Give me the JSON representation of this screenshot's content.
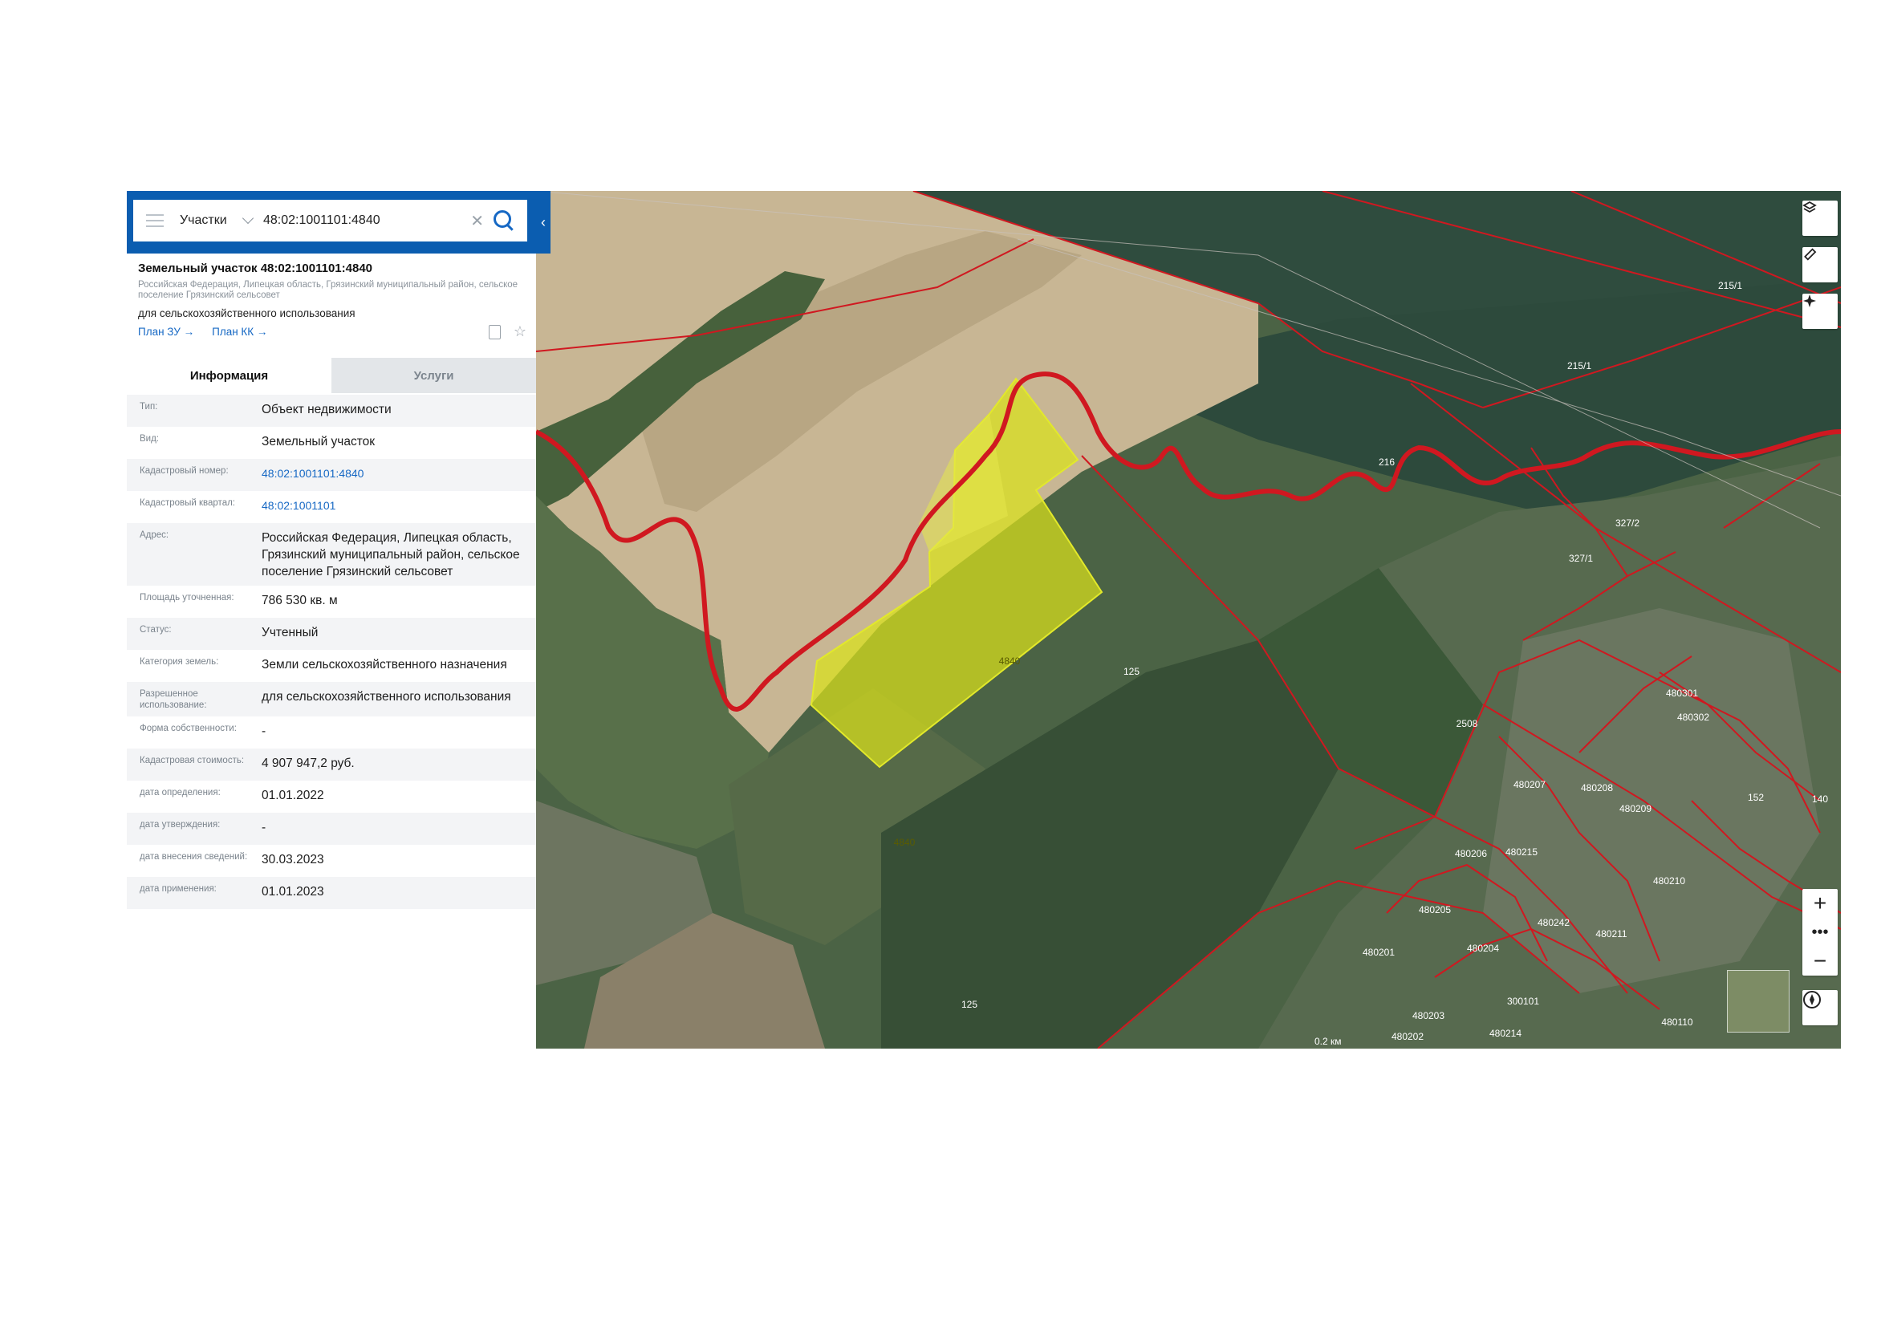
{
  "search": {
    "layer": "Участки",
    "query": "48:02:1001101:4840"
  },
  "object": {
    "title": "Земельный участок 48:02:1001101:4840",
    "address_short": "Российская Федерация, Липецкая область, Грязинский муниципальный район, сельское поселение Грязинский сельсовет",
    "use": "для сельскохозяйственного использования",
    "link_plan_zu": "План ЗУ →",
    "link_plan_kk": "План КК →"
  },
  "tabs": {
    "info": "Информация",
    "services": "Услуги"
  },
  "rows": [
    {
      "label": "Тип:",
      "value": "Объект недвижимости"
    },
    {
      "label": "Вид:",
      "value": "Земельный участок"
    },
    {
      "label": "Кадастровый номер:",
      "value": "48:02:1001101:4840"
    },
    {
      "label": "Кадастровый квартал:",
      "value": "48:02:1001101"
    },
    {
      "label": "Адрес:",
      "value": "Российская Федерация, Липецкая область, Грязинский муниципальный район, сельское поселение Грязинский сельсовет"
    },
    {
      "label": "Площадь уточненная:",
      "value": "786 530 кв. м"
    },
    {
      "label": "Статус:",
      "value": "Учтенный"
    },
    {
      "label": "Категория земель:",
      "value": "Земли сельскохозяйственного назначения"
    },
    {
      "label": "Разрешенное использование:",
      "value": "для сельскохозяйственного использования"
    },
    {
      "label": "Форма собственности:",
      "value": "-"
    },
    {
      "label": "Кадастровая стоимость:",
      "value": "4 907 947,2 руб."
    },
    {
      "label": "дата определения:",
      "value": "01.01.2022"
    },
    {
      "label": "дата утверждения:",
      "value": "-"
    },
    {
      "label": "дата внесения сведений:",
      "value": "30.03.2023"
    },
    {
      "label": "дата применения:",
      "value": "01.01.2023"
    }
  ],
  "map": {
    "parcel_labels": [
      "4840",
      "4840",
      "125",
      "125",
      "216",
      "215/1",
      "215/1",
      "2508",
      "327/1",
      "327/2",
      "480301",
      "480302",
      "480207",
      "480208",
      "480209",
      "480206",
      "480215",
      "480205",
      "480210",
      "480204",
      "480211",
      "480201",
      "480242",
      "480203",
      "480202",
      "480214",
      "480110",
      "300101",
      "152",
      "140"
    ],
    "scale_label": "0.2 км",
    "colors": {
      "parcel_fill": "#d9e21a",
      "boundary": "#d01820",
      "field": "#c7b495",
      "forest": "#3d5a3a"
    }
  },
  "icons": [
    "menu-icon",
    "chevron-down-icon",
    "clear-icon",
    "search-icon",
    "collapse-chevron-icon",
    "document-icon",
    "star-icon",
    "layers-icon",
    "ruler-icon",
    "locate-icon",
    "zoom-in-icon",
    "more-icon",
    "zoom-out-icon",
    "compass-icon"
  ]
}
